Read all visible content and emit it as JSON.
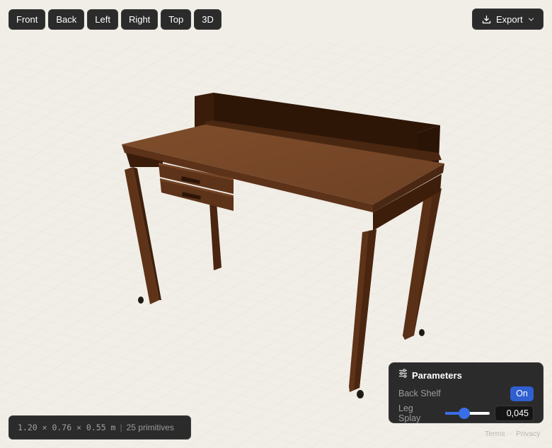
{
  "toolbar": {
    "views": [
      "Front",
      "Back",
      "Left",
      "Right",
      "Top",
      "3D"
    ],
    "export_label": "Export"
  },
  "status": {
    "dimensions": "1.20 × 0.76 × 0.55 m",
    "separator": "|",
    "primitives": "25 primitives"
  },
  "parameters": {
    "title": "Parameters",
    "back_shelf": {
      "label": "Back Shelf",
      "value": "On"
    },
    "leg_splay": {
      "label": "Leg Splay",
      "value": "0,045",
      "slider_fraction": 0.43
    }
  },
  "footer": {
    "terms": "Terms",
    "separator": "·",
    "privacy": "Privacy"
  },
  "colors": {
    "background": "#f1eee7",
    "panel": "#2b2b2b",
    "accent": "#3a6ee8",
    "wood_top": "#7a4a2a",
    "wood_dark": "#3a1d0c"
  },
  "icons": [
    "download-icon",
    "chevron-down-icon",
    "sliders-icon"
  ]
}
